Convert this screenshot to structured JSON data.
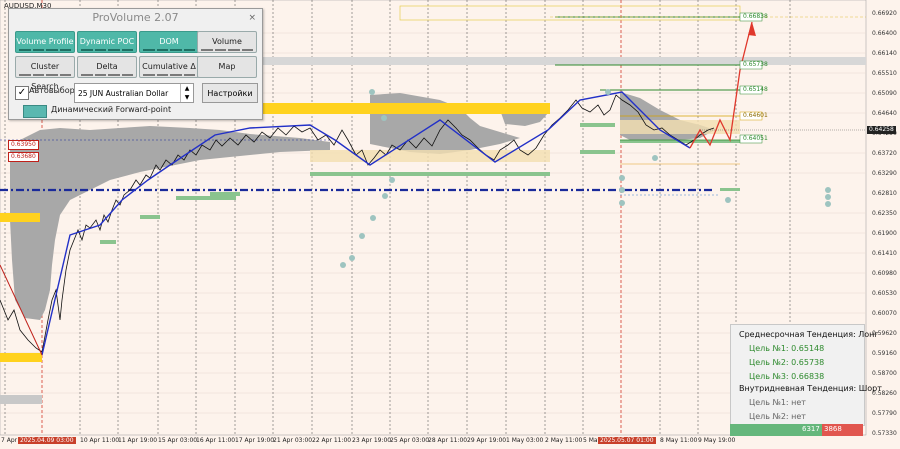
{
  "symbol_label": "AUDUSD,M30",
  "panel": {
    "title": "ProVolume 2.07",
    "close": "×",
    "buttons": {
      "volume_profile": "Volume Profile",
      "dynamic_poc": "Dynamic POC",
      "dom": "DOM",
      "volume": "Volume",
      "cluster_search": "Cluster Search",
      "delta": "Delta",
      "cumulative_delta": "Cumulative Δ",
      "map": "Map"
    },
    "auto_check": "✓",
    "auto_label": "Автовыбор",
    "contract": "25 JUN Australian Dollar",
    "settings": "Настройки",
    "forward_label": "Динамический Forward-point"
  },
  "left_labels": {
    "l1": "0.63950",
    "l2": "0.63680"
  },
  "level_labels": {
    "t1": "0.66838",
    "t2": "0.65738",
    "t3": "0.65148",
    "m1": "0.64601",
    "m2": "0.64051"
  },
  "current_price": "0.64258",
  "price_axis": [
    "0.66920",
    "0.66400",
    "0.66140",
    "0.65510",
    "0.65090",
    "0.64640",
    "0.64250",
    "0.63720",
    "0.63290",
    "0.62810",
    "0.62350",
    "0.61900",
    "0.61410",
    "0.60980",
    "0.60530",
    "0.60070",
    "0.59620",
    "0.59160",
    "0.58700",
    "0.58260",
    "0.57790",
    "0.57330"
  ],
  "time_axis": [
    "7 Apr 2025",
    "2025.04.09 03:00",
    "10 Apr 11:00",
    "11 Apr 19:00",
    "15 Apr 03:00",
    "16 Apr 11:00",
    "17 Apr 19:00",
    "21 Apr 03:00",
    "22 Apr 11:00",
    "23 Apr 19:00",
    "25 Apr 03:00",
    "28 Apr 11:00",
    "29 Apr 19:00",
    "1 May 03:00",
    "2 May 11:00",
    "5 May",
    "2025.05.07 01:00",
    "8 May 11:00",
    "9 May 19:00"
  ],
  "trend": {
    "mid_title": "Среднесрочная Тенденция: Лонг",
    "t1": "Цель №1: 0.65148",
    "t2": "Цель №2: 0.65738",
    "t3": "Цель №3: 0.66838",
    "intra_title": "Внутридневная Тенденция: Шорт",
    "i1": "Цель №1: нет",
    "i2": "Цель №2: нет"
  },
  "volume_bar": {
    "buy": "6317",
    "sell": "3868"
  },
  "colors": {
    "panel_accent": "#4fb8a8",
    "poc_line": "#1a2a9a",
    "target_line": "#2e8a2e",
    "forecast": "#e0382c",
    "profile_yellow": "#ffd21e"
  }
}
